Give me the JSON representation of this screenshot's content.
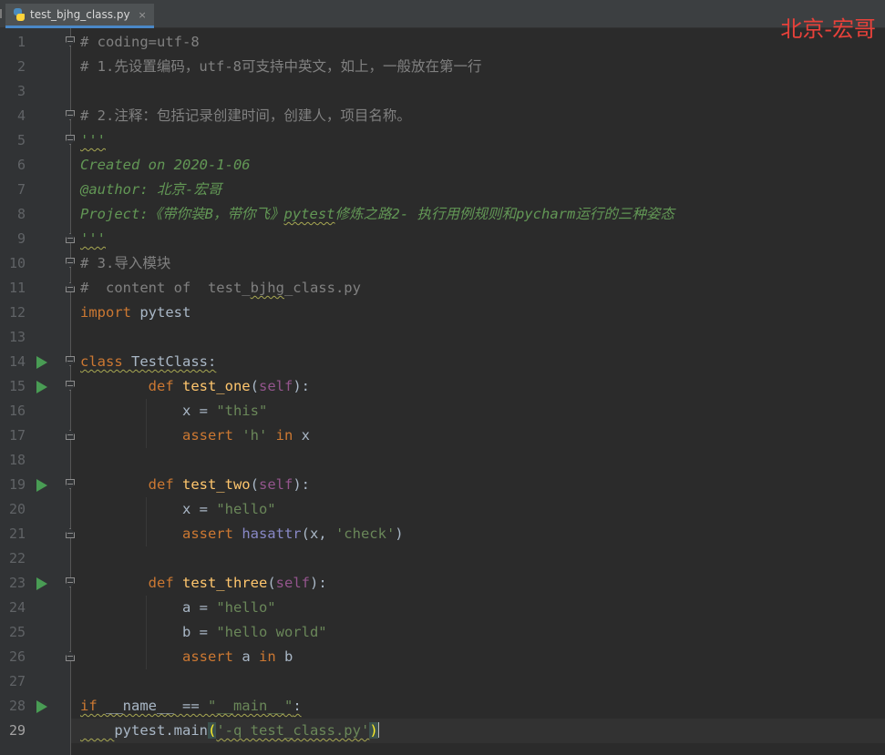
{
  "tab": {
    "filename": "test_bjhg_class.py",
    "close_glyph": "×",
    "icon": "python-file-icon"
  },
  "watermark": "北京-宏哥",
  "colors": {
    "background": "#2b2b2b",
    "gutter": "#313335",
    "comment": "#808080",
    "docstring": "#629755",
    "keyword": "#cc7832",
    "function": "#ffc66d",
    "self": "#94558d",
    "string": "#6a8759",
    "builtin": "#8888c6",
    "watermark": "#e8413a",
    "run_icon": "#499c54"
  },
  "editor": {
    "current_line": 29,
    "lines": [
      {
        "n": "1",
        "fold": "open",
        "run": false,
        "tokens": [
          [
            "comment",
            "# coding=utf-8"
          ]
        ]
      },
      {
        "n": "2",
        "fold": "",
        "run": false,
        "tokens": [
          [
            "comment",
            "# 1.先设置编码，utf-8可支持中英文，如上，一般放在第一行"
          ]
        ]
      },
      {
        "n": "3",
        "fold": "",
        "run": false,
        "tokens": []
      },
      {
        "n": "4",
        "fold": "open",
        "run": false,
        "tokens": [
          [
            "comment",
            "# 2.注释：包括记录创建时间，创建人，项目名称。"
          ]
        ]
      },
      {
        "n": "5",
        "fold": "open",
        "run": false,
        "tokens": [
          [
            "doc_sq",
            "'''"
          ]
        ]
      },
      {
        "n": "6",
        "fold": "",
        "run": false,
        "tokens": [
          [
            "doc",
            "Created on 2020-1-06"
          ]
        ]
      },
      {
        "n": "7",
        "fold": "",
        "run": false,
        "tokens": [
          [
            "doc",
            "@author: 北京-宏哥"
          ]
        ]
      },
      {
        "n": "8",
        "fold": "",
        "run": false,
        "tokens": [
          [
            "doc",
            "Project:《带你装B，带你飞》"
          ],
          [
            "doc_sq",
            "pytest"
          ],
          [
            "doc",
            "修炼之路2- 执行用例规则和pycharm运行的三种姿态"
          ]
        ]
      },
      {
        "n": "9",
        "fold": "close",
        "run": false,
        "tokens": [
          [
            "doc_sq",
            "'''"
          ]
        ]
      },
      {
        "n": "10",
        "fold": "open",
        "run": false,
        "tokens": [
          [
            "comment",
            "# 3.导入模块"
          ]
        ]
      },
      {
        "n": "11",
        "fold": "close",
        "run": false,
        "tokens": [
          [
            "comment",
            "#  content of  test_"
          ],
          [
            "comment_sq",
            "bjhg"
          ],
          [
            "comment",
            "_class.py"
          ]
        ]
      },
      {
        "n": "12",
        "fold": "",
        "run": false,
        "tokens": [
          [
            "kw",
            "import "
          ],
          [
            "plain",
            "pytest"
          ]
        ]
      },
      {
        "n": "13",
        "fold": "",
        "run": false,
        "tokens": []
      },
      {
        "n": "14",
        "fold": "open",
        "run": true,
        "tokens": [
          [
            "kw_sq",
            "class "
          ],
          [
            "plain_sq",
            "TestClass:"
          ]
        ]
      },
      {
        "n": "15",
        "fold": "open",
        "run": true,
        "tokens": [
          [
            "plain",
            "        "
          ],
          [
            "kw",
            "def "
          ],
          [
            "fn",
            "test_one"
          ],
          [
            "plain",
            "("
          ],
          [
            "self",
            "self"
          ],
          [
            "plain",
            "):"
          ]
        ]
      },
      {
        "n": "16",
        "fold": "",
        "run": false,
        "tokens": [
          [
            "plain",
            "            x = "
          ],
          [
            "str",
            "\"this\""
          ]
        ]
      },
      {
        "n": "17",
        "fold": "close",
        "run": false,
        "tokens": [
          [
            "plain",
            "            "
          ],
          [
            "kw",
            "assert "
          ],
          [
            "str",
            "'h' "
          ],
          [
            "kw",
            "in "
          ],
          [
            "plain",
            "x"
          ]
        ]
      },
      {
        "n": "18",
        "fold": "",
        "run": false,
        "tokens": []
      },
      {
        "n": "19",
        "fold": "open",
        "run": true,
        "tokens": [
          [
            "plain",
            "        "
          ],
          [
            "kw",
            "def "
          ],
          [
            "fn",
            "test_two"
          ],
          [
            "plain",
            "("
          ],
          [
            "self",
            "self"
          ],
          [
            "plain",
            "):"
          ]
        ]
      },
      {
        "n": "20",
        "fold": "",
        "run": false,
        "tokens": [
          [
            "plain",
            "            x = "
          ],
          [
            "str",
            "\"hello\""
          ]
        ]
      },
      {
        "n": "21",
        "fold": "close",
        "run": false,
        "tokens": [
          [
            "plain",
            "            "
          ],
          [
            "kw",
            "assert "
          ],
          [
            "builtin",
            "hasattr"
          ],
          [
            "plain",
            "(x, "
          ],
          [
            "str",
            "'check'"
          ],
          [
            "plain",
            ")"
          ]
        ]
      },
      {
        "n": "22",
        "fold": "",
        "run": false,
        "tokens": []
      },
      {
        "n": "23",
        "fold": "open",
        "run": true,
        "tokens": [
          [
            "plain",
            "        "
          ],
          [
            "kw",
            "def "
          ],
          [
            "fn",
            "test_three"
          ],
          [
            "plain",
            "("
          ],
          [
            "self",
            "self"
          ],
          [
            "plain",
            "):"
          ]
        ]
      },
      {
        "n": "24",
        "fold": "",
        "run": false,
        "tokens": [
          [
            "plain",
            "            a = "
          ],
          [
            "str",
            "\"hello\""
          ]
        ]
      },
      {
        "n": "25",
        "fold": "",
        "run": false,
        "tokens": [
          [
            "plain",
            "            b = "
          ],
          [
            "str",
            "\"hello world\""
          ]
        ]
      },
      {
        "n": "26",
        "fold": "close",
        "run": false,
        "tokens": [
          [
            "plain",
            "            "
          ],
          [
            "kw",
            "assert "
          ],
          [
            "plain",
            "a "
          ],
          [
            "kw",
            "in "
          ],
          [
            "plain",
            "b"
          ]
        ]
      },
      {
        "n": "27",
        "fold": "",
        "run": false,
        "tokens": []
      },
      {
        "n": "28",
        "fold": "",
        "run": true,
        "tokens": [
          [
            "kw_sq",
            "if "
          ],
          [
            "plain_sq",
            "__name__ == "
          ],
          [
            "str_sq",
            "\"__main__\""
          ],
          [
            "plain_sq",
            ":"
          ]
        ]
      },
      {
        "n": "29",
        "fold": "",
        "run": false,
        "tokens": [
          [
            "plain_sq",
            "    "
          ],
          [
            "plain",
            "pytest.main"
          ],
          [
            "paren",
            "("
          ],
          [
            "str_sq",
            "'-q test_class.py'"
          ],
          [
            "paren",
            ")"
          ]
        ]
      }
    ]
  }
}
